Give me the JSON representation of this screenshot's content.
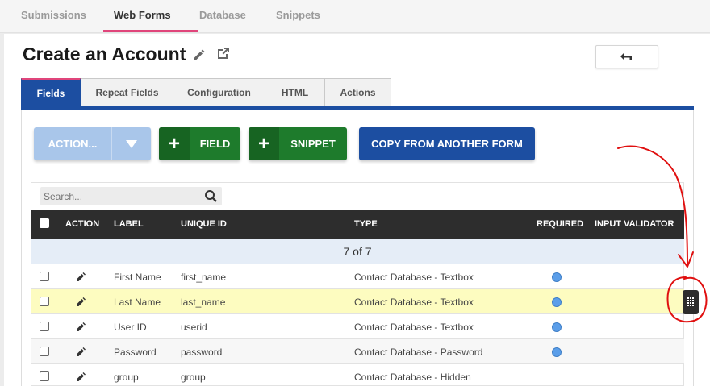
{
  "topnav": {
    "tabs": [
      {
        "label": "Submissions"
      },
      {
        "label": "Web Forms",
        "active": true
      },
      {
        "label": "Database"
      },
      {
        "label": "Snippets"
      }
    ]
  },
  "page": {
    "title": "Create an Account",
    "edit_icon": "pencil-icon",
    "open_icon": "external-link-icon",
    "back_icon": "undo-arrow-icon"
  },
  "subtabs": [
    {
      "label": "Fields",
      "active": true
    },
    {
      "label": "Repeat Fields"
    },
    {
      "label": "Configuration"
    },
    {
      "label": "HTML"
    },
    {
      "label": "Actions"
    }
  ],
  "toolbar": {
    "action_label": "ACTION...",
    "field_label": "FIELD",
    "snippet_label": "SNIPPET",
    "copy_label": "COPY FROM ANOTHER FORM"
  },
  "search": {
    "placeholder": "Search..."
  },
  "table": {
    "headers": {
      "action": "ACTION",
      "label": "LABEL",
      "unique_id": "UNIQUE ID",
      "type": "TYPE",
      "required": "REQUIRED",
      "input_validator": "INPUT VALIDATOR"
    },
    "count": "7 of 7",
    "rows": [
      {
        "label": "First Name",
        "unique_id": "first_name",
        "type": "Contact Database - Textbox",
        "required": true
      },
      {
        "label": "Last Name",
        "unique_id": "last_name",
        "type": "Contact Database - Textbox",
        "required": true
      },
      {
        "label": "User ID",
        "unique_id": "userid",
        "type": "Contact Database - Textbox",
        "required": true
      },
      {
        "label": "Password",
        "unique_id": "password",
        "type": "Contact Database - Password",
        "required": true
      },
      {
        "label": "group",
        "unique_id": "group",
        "type": "Contact Database - Hidden",
        "required": false
      }
    ]
  },
  "colors": {
    "primary_blue": "#1c4ea1",
    "green": "#1e7b2c",
    "accent_pink": "#e0457b",
    "highlight_row": "#fdfcc0",
    "required_dot": "#5b9ee9",
    "annotation_red": "#e01010"
  }
}
